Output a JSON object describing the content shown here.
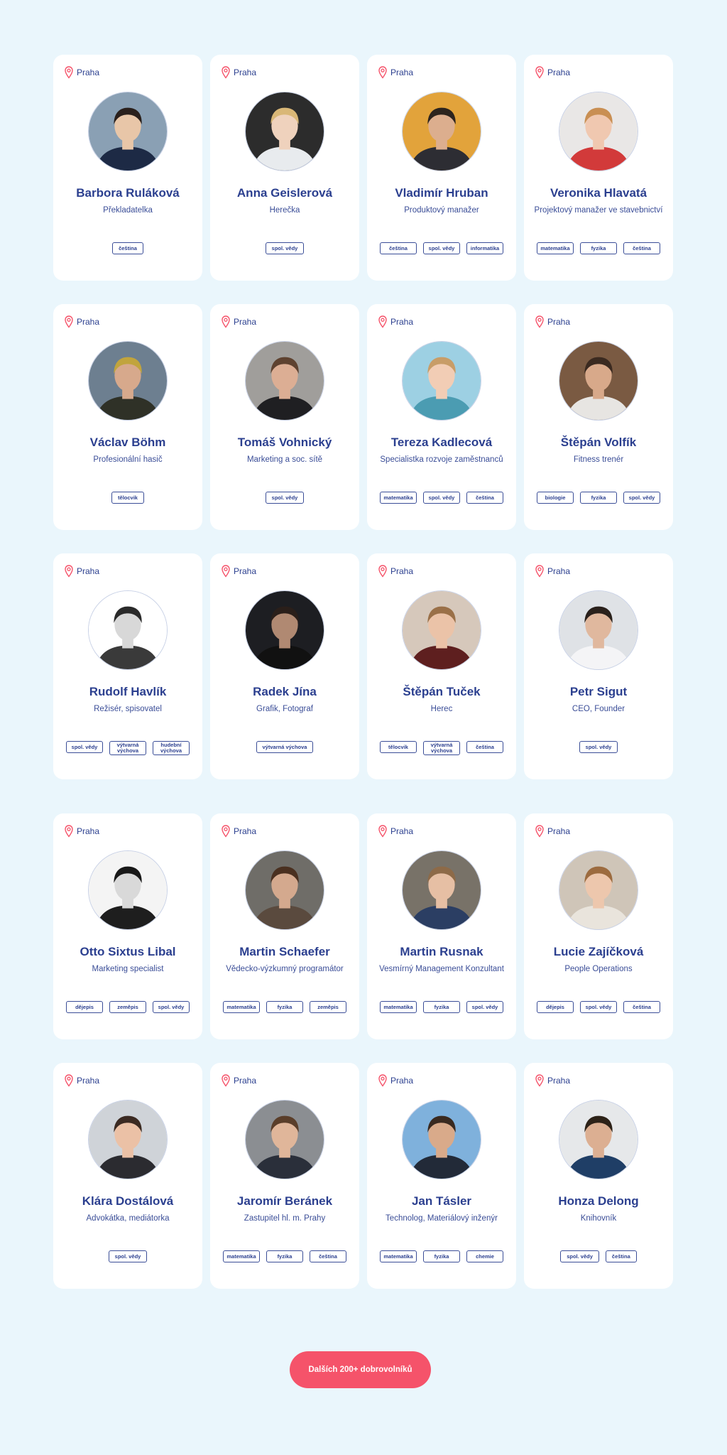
{
  "colors": {
    "background": "#eaf6fc",
    "card": "#ffffff",
    "text": "#2b3f8f",
    "accent": "#f5536a"
  },
  "pin_icon": "map-pin-icon",
  "volunteers": [
    {
      "city": "Praha",
      "name": "Barbora Ruláková",
      "role": "Překladatelka",
      "tags": [
        "čeština"
      ],
      "skin": "#e8c6a8",
      "hair": "#2a201c",
      "shirt": "#1d2a45",
      "bg": "#8aa0b4"
    },
    {
      "city": "Praha",
      "name": "Anna Geislerová",
      "role": "Herečka",
      "tags": [
        "spol. vědy"
      ],
      "skin": "#efd2bd",
      "hair": "#d9b777",
      "shirt": "#e8ebee",
      "bg": "#2c2c2c"
    },
    {
      "city": "Praha",
      "name": "Vladimír Hruban",
      "role": "Produktový manažer",
      "tags": [
        "čeština",
        "spol. vědy",
        "informatika"
      ],
      "skin": "#dcae8e",
      "hair": "#2c241e",
      "shirt": "#2d2d33",
      "bg": "#e2a33b"
    },
    {
      "city": "Praha",
      "name": "Veronika Hlavatá",
      "role": "Projektový manažer ve stavebnictví",
      "tags": [
        "matematika",
        "fyzika",
        "čeština"
      ],
      "skin": "#f0c8b0",
      "hair": "#c98f53",
      "shirt": "#d23a3a",
      "bg": "#e9e7e6"
    },
    {
      "city": "Praha",
      "name": "Václav Böhm",
      "role": "Profesionální hasič",
      "tags": [
        "tělocvik"
      ],
      "skin": "#d7a98c",
      "hair": "#c1a43d",
      "shirt": "#2f3127",
      "bg": "#6d7f90"
    },
    {
      "city": "Praha",
      "name": "Tomáš Vohnický",
      "role": "Marketing a soc. sítě",
      "tags": [
        "spol. vědy"
      ],
      "skin": "#dcae94",
      "hair": "#5e4230",
      "shirt": "#1f1f22",
      "bg": "#a09e9b"
    },
    {
      "city": "Praha",
      "name": "Tereza Kadlecová",
      "role": "Specialistka rozvoje zaměstnanců",
      "tags": [
        "matematika",
        "spol. vědy",
        "čeština"
      ],
      "skin": "#f2cdb5",
      "hair": "#c89d68",
      "shirt": "#4b9cb2",
      "bg": "#9dd0e3"
    },
    {
      "city": "Praha",
      "name": "Štěpán Volfík",
      "role": "Fitness trenér",
      "tags": [
        "biologie",
        "fyzika",
        "spol. vědy"
      ],
      "skin": "#d8a98a",
      "hair": "#3b2a20",
      "shirt": "#e7e5e2",
      "bg": "#7a5a42"
    },
    {
      "city": "Praha",
      "name": "Rudolf Havlík",
      "role": "Režisér, spisovatel",
      "tags": [
        "spol. vědy",
        "výtvarná výchova",
        "hudební výchova"
      ],
      "skin": "#d8d8d8",
      "hair": "#2a2a2a",
      "shirt": "#3a3a3a",
      "bg": "#ffffff"
    },
    {
      "city": "Praha",
      "name": "Radek Jína",
      "role": "Grafik, Fotograf",
      "tags": [
        "výtvarná výchova"
      ],
      "skin": "#b08972",
      "hair": "#2a1f1a",
      "shirt": "#111111",
      "bg": "#1d1e22"
    },
    {
      "city": "Praha",
      "name": "Štěpán Tuček",
      "role": "Herec",
      "tags": [
        "tělocvik",
        "výtvarná výchova",
        "čeština"
      ],
      "skin": "#ebc3a8",
      "hair": "#9a7048",
      "shirt": "#5e1f1f",
      "bg": "#d6c8bb"
    },
    {
      "city": "Praha",
      "name": "Petr Sigut",
      "role": "CEO, Founder",
      "tags": [
        "spol. vědy"
      ],
      "skin": "#e0b89e",
      "hair": "#2a211c",
      "shirt": "#f4f4f6",
      "bg": "#dfe2e6"
    },
    {
      "city": "Praha",
      "name": "Otto Sixtus Libal",
      "role": "Marketing specialist",
      "tags": [
        "dějepis",
        "zeměpis",
        "spol. vědy"
      ],
      "skin": "#d9d9d9",
      "hair": "#181818",
      "shirt": "#1e1e1e",
      "bg": "#f4f4f4"
    },
    {
      "city": "Praha",
      "name": "Martin Schaefer",
      "role": "Vědecko-výzkumný programátor",
      "tags": [
        "matematika",
        "fyzika",
        "zeměpis"
      ],
      "skin": "#d4a98e",
      "hair": "#4a3020",
      "shirt": "#5a4a3e",
      "bg": "#6f6d68"
    },
    {
      "city": "Praha",
      "name": "Martin Rusnak",
      "role": "Vesmírný Management Konzultant",
      "tags": [
        "matematika",
        "fyzika",
        "spol. vědy"
      ],
      "skin": "#e6bfa4",
      "hair": "#8d6a48",
      "shirt": "#2b3e63",
      "bg": "#787268"
    },
    {
      "city": "Praha",
      "name": "Lucie Zajíčková",
      "role": "People Operations",
      "tags": [
        "dějepis",
        "spol. vědy",
        "čeština"
      ],
      "skin": "#edc7ad",
      "hair": "#9c6b3f",
      "shirt": "#e9e4dc",
      "bg": "#cfc5b8"
    },
    {
      "city": "Praha",
      "name": "Klára Dostálová",
      "role": "Advokátka, mediátorka",
      "tags": [
        "spol. vědy"
      ],
      "skin": "#ebc1a6",
      "hair": "#3b2a22",
      "shirt": "#2b2b30",
      "bg": "#cfd3d8"
    },
    {
      "city": "Praha",
      "name": "Jaromír Beránek",
      "role": "Zastupitel hl. m. Prahy",
      "tags": [
        "matematika",
        "fyzika",
        "čeština"
      ],
      "skin": "#e0b69a",
      "hair": "#5a3e2a",
      "shirt": "#2a2f3a",
      "bg": "#8b8e92"
    },
    {
      "city": "Praha",
      "name": "Jan Tásler",
      "role": "Technolog, Materiálový inženýr",
      "tags": [
        "matematika",
        "fyzika",
        "chemie"
      ],
      "skin": "#d9aa8a",
      "hair": "#3a2a20",
      "shirt": "#222a38",
      "bg": "#7fb1dc"
    },
    {
      "city": "Praha",
      "name": "Honza Delong",
      "role": "Knihovník",
      "tags": [
        "spol. vědy",
        "čeština"
      ],
      "skin": "#dcaf92",
      "hair": "#2d2218",
      "shirt": "#1f3e66",
      "bg": "#e6e8ea"
    }
  ],
  "cta": {
    "label": "Dalších 200+ dobrovolníků"
  }
}
